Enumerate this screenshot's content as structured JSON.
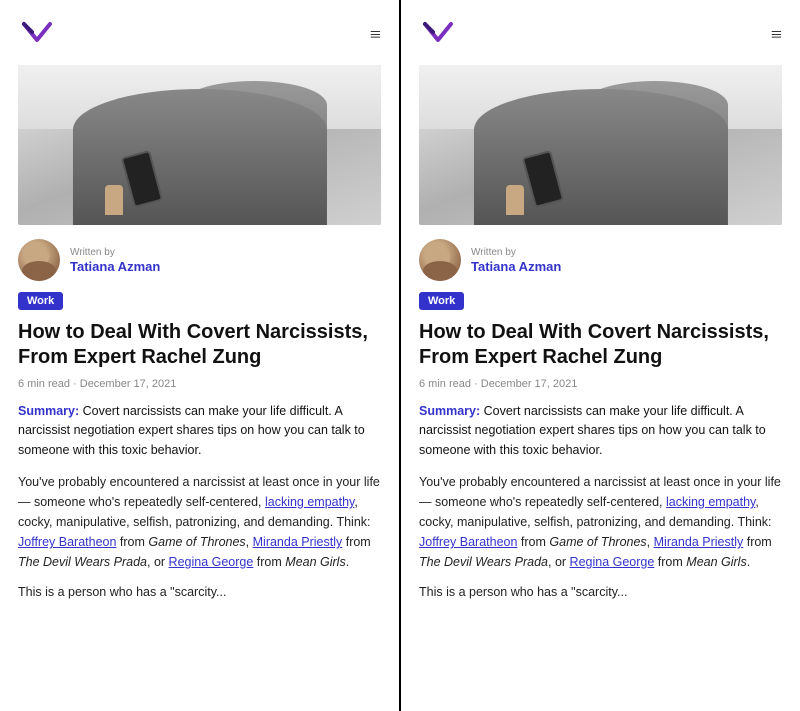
{
  "panels": [
    {
      "id": "panel-left",
      "header": {
        "logo_alt": "Wort logo",
        "menu_icon": "≡"
      },
      "author": {
        "written_by": "Written by",
        "name": "Tatiana Azman"
      },
      "tag": "Work",
      "title": "How to Deal With Covert Narcissists, From Expert Rachel Zung",
      "meta": "6 min read · December 17, 2021",
      "summary_label": "Summary:",
      "summary_text": " Covert narcissists can make your life difficult. A narcissist negotiation expert shares tips on how you can talk to someone with this toxic behavior.",
      "body1": "You've probably encountered a narcissist at least once in your life — someone who's repeatedly self-centered, ",
      "body1_link1": "lacking empathy",
      "body1_mid": ", cocky, manipulative, selfish, patronizing, and demanding. Think: ",
      "body1_link2": "Joffrey Baratheon",
      "body1_after_link2": " from ",
      "body1_italic1": "Game of Thrones",
      "body1_comma": ", ",
      "body1_link3": "Miranda Priestly",
      "body1_after_link3": " from ",
      "body1_italic2": "The Devil Wears Prada",
      "body1_or": ", or ",
      "body1_link4": "Regina George",
      "body1_after_link4": " from ",
      "body1_italic3": "Mean Girls",
      "body1_period": ".",
      "body2": "This is a person who has a \"scarcity..."
    },
    {
      "id": "panel-right",
      "header": {
        "logo_alt": "Wort logo",
        "menu_icon": "≡"
      },
      "author": {
        "written_by": "Written by",
        "name": "Tatiana Azman"
      },
      "tag": "Work",
      "title": "How to Deal With Covert Narcissists, From Expert Rachel Zung",
      "meta": "6 min read · December 17, 2021",
      "summary_label": "Summary:",
      "summary_text": " Covert narcissists can make your life difficult. A narcissist negotiation expert shares tips on how you can talk to someone with this toxic behavior.",
      "body1": "You've probably encountered a narcissist at least once in your life — someone who's repeatedly self-centered, ",
      "body1_link1": "lacking empathy",
      "body1_mid": ", cocky, manipulative, selfish, patronizing, and demanding. Think: ",
      "body1_link2": "Joffrey Baratheon",
      "body1_after_link2": " from ",
      "body1_italic1": "Game of Thrones",
      "body1_comma": ", ",
      "body1_link3": "Miranda Priestly",
      "body1_after_link3": " from ",
      "body1_italic2": "The Devil Wears Prada",
      "body1_or": ", or ",
      "body1_link4": "Regina George",
      "body1_after_link4": " from ",
      "body1_italic3": "Mean Girls",
      "body1_period": ".",
      "body2": "This is a person who has a \"scarcity..."
    }
  ],
  "colors": {
    "accent": "#3333cc",
    "tag_bg": "#3333cc",
    "tag_text": "#ffffff",
    "title_text": "#111111",
    "meta_text": "#888888",
    "body_text": "#222222"
  }
}
